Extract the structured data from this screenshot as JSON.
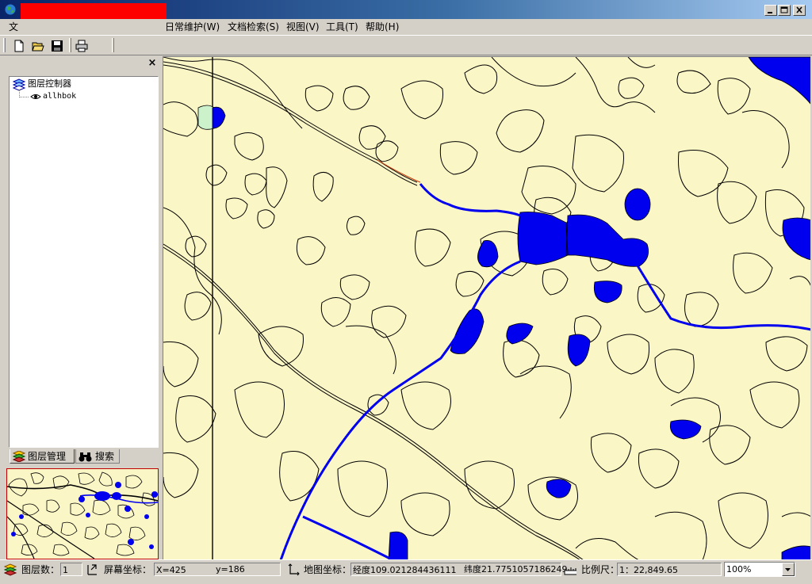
{
  "window": {
    "title": "",
    "redact_color": "#ff0000"
  },
  "menu": [
    {
      "label": "文"
    },
    {
      "label": "日常维护(W)"
    },
    {
      "label": "文档检索(S)"
    },
    {
      "label": "视图(V)"
    },
    {
      "label": "工具(T)"
    },
    {
      "label": "帮助(H)"
    }
  ],
  "toolbar": {
    "buttons": [
      "new-file-icon",
      "open-folder-icon",
      "save-icon",
      "print-icon"
    ]
  },
  "left_panel": {
    "close_glyph": "×",
    "tree": {
      "root_label": "图层控制器",
      "layers": [
        {
          "label": "allhbok",
          "visible": true
        }
      ]
    },
    "tabs": [
      {
        "label": "图层管理"
      },
      {
        "label": "搜索"
      }
    ]
  },
  "map": {
    "colors": {
      "land": "#fbf6c6",
      "water": "#0000ee",
      "light_green": "#ccf2cc",
      "outline": "#000000",
      "highlight": "#cc3300"
    }
  },
  "statusbar": {
    "layers_label": "图层数：",
    "layers_value": "1",
    "screen_label": "屏幕坐标：",
    "screen_x": "X=425",
    "screen_y": "y=186",
    "map_label": "地图坐标：",
    "longitude": "经度109.021284436111",
    "latitude": "纬度21.7751057186249",
    "scale_label": "比例尺：",
    "scale_value": "1：22,849.65",
    "zoom": "100%"
  }
}
